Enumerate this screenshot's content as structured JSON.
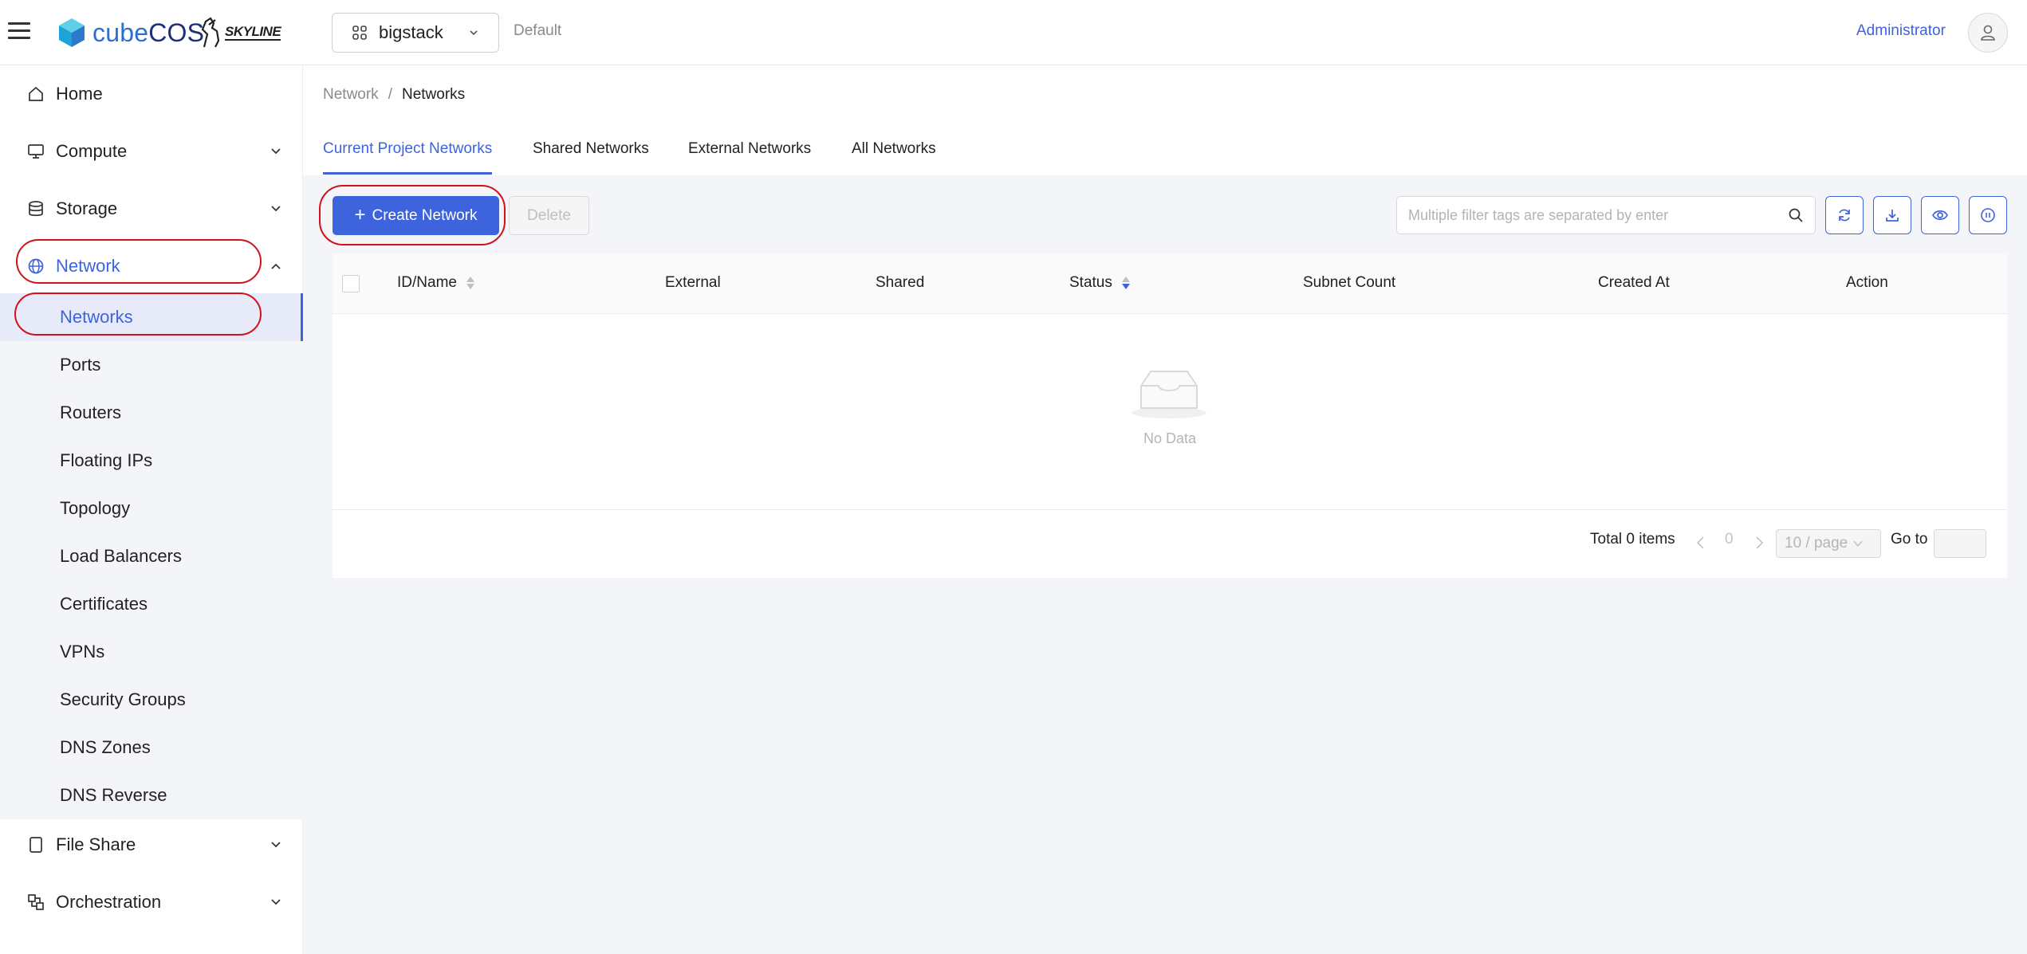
{
  "header": {
    "logo_text_light": "cube",
    "logo_text_bold": "COS",
    "partner_logo": "SKYLINE",
    "project": "bigstack",
    "domain": "Default",
    "user": "Administrator"
  },
  "sidebar": {
    "items": [
      {
        "label": "Home",
        "icon": "home-icon"
      },
      {
        "label": "Compute",
        "icon": "monitor-icon"
      },
      {
        "label": "Storage",
        "icon": "database-icon"
      },
      {
        "label": "Network",
        "icon": "globe-icon"
      },
      {
        "label": "File Share",
        "icon": "file-icon"
      },
      {
        "label": "Orchestration",
        "icon": "orchestration-icon"
      }
    ],
    "network_sub": [
      "Networks",
      "Ports",
      "Routers",
      "Floating IPs",
      "Topology",
      "Load Balancers",
      "Certificates",
      "VPNs",
      "Security Groups",
      "DNS Zones",
      "DNS Reverse"
    ]
  },
  "breadcrumb": {
    "parent": "Network",
    "separator": "/",
    "current": "Networks"
  },
  "tabs": [
    "Current Project Networks",
    "Shared Networks",
    "External Networks",
    "All Networks"
  ],
  "toolbar": {
    "create_label": "Create Network",
    "delete_label": "Delete",
    "search_placeholder": "Multiple filter tags are separated by enter"
  },
  "table": {
    "columns": [
      "ID/Name",
      "External",
      "Shared",
      "Status",
      "Subnet Count",
      "Created At",
      "Action"
    ],
    "empty_text": "No Data"
  },
  "pagination": {
    "total": "Total 0 items",
    "page": "0",
    "page_size": "10 / page",
    "goto": "Go to"
  },
  "colors": {
    "accent": "#3d63dd",
    "highlight_ring": "#d1121b"
  }
}
